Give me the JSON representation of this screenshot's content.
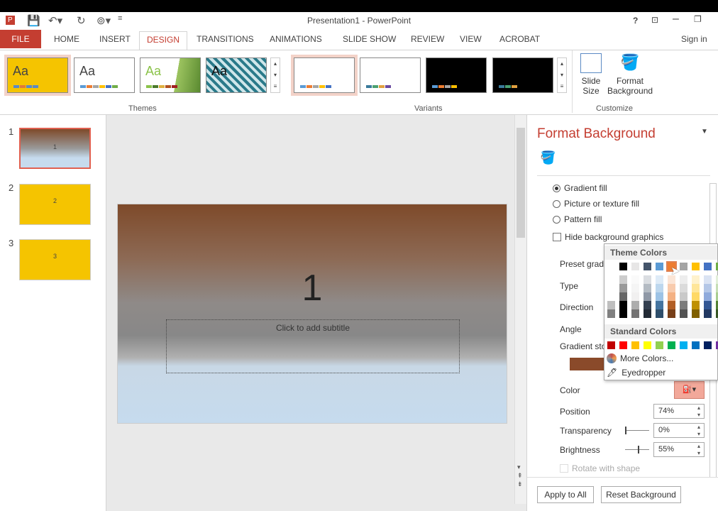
{
  "window": {
    "title": "Presentation1 - PowerPoint",
    "help": "?",
    "signin": "Sign in"
  },
  "tabs": [
    "FILE",
    "HOME",
    "INSERT",
    "DESIGN",
    "TRANSITIONS",
    "ANIMATIONS",
    "SLIDE SHOW",
    "REVIEW",
    "VIEW",
    "ACROBAT"
  ],
  "active_tab": "DESIGN",
  "ribbon": {
    "themes": {
      "label": "Themes",
      "sample": "Aa"
    },
    "variants": {
      "label": "Variants"
    },
    "customize": {
      "label": "Customize",
      "slide_size": "Slide Size",
      "format_background": "Format Background"
    }
  },
  "slides": [
    {
      "num": "1",
      "text": "1"
    },
    {
      "num": "2",
      "text": "2"
    },
    {
      "num": "3",
      "text": "3"
    }
  ],
  "slide": {
    "title": "1",
    "subtitle_placeholder": "Click to add subtitle"
  },
  "panel": {
    "title": "Format Background",
    "fill_options": [
      {
        "label": "Gradient fill",
        "selected": true
      },
      {
        "label": "Picture or texture fill",
        "selected": false
      },
      {
        "label": "Pattern fill",
        "selected": false
      }
    ],
    "hide_bg": {
      "label": "Hide background graphics",
      "checked": false
    },
    "labels": {
      "preset": "Preset gradi",
      "type": "Type",
      "direction": "Direction",
      "angle": "Angle",
      "stops": "Gradient sto",
      "color": "Color",
      "position": "Position",
      "transparency": "Transparency",
      "brightness": "Brightness",
      "rotate": "Rotate with shape"
    },
    "position": "74%",
    "transparency": "0%",
    "brightness": "55%",
    "transparency_level": 0,
    "brightness_level": 55,
    "apply_all": "Apply to All",
    "reset": "Reset Background"
  },
  "color_picker": {
    "theme_header": "Theme Colors",
    "standard_header": "Standard Colors",
    "theme_colors": [
      "#ffffff",
      "#000000",
      "#e7e6e6",
      "#44546a",
      "#5b9bd5",
      "#ed7d31",
      "#a5a5a5",
      "#ffc000",
      "#4472c4",
      "#70ad47"
    ],
    "standard_colors": [
      "#c00000",
      "#ff0000",
      "#ffc000",
      "#ffff00",
      "#92d050",
      "#00b050",
      "#00b0f0",
      "#0070c0",
      "#002060",
      "#7030a0"
    ],
    "selected": "#ed7d31",
    "more_colors": "More Colors...",
    "eyedropper": "Eyedropper"
  },
  "colors": {
    "accent": "#c43e31",
    "theme_yellow": "#f5c400"
  }
}
